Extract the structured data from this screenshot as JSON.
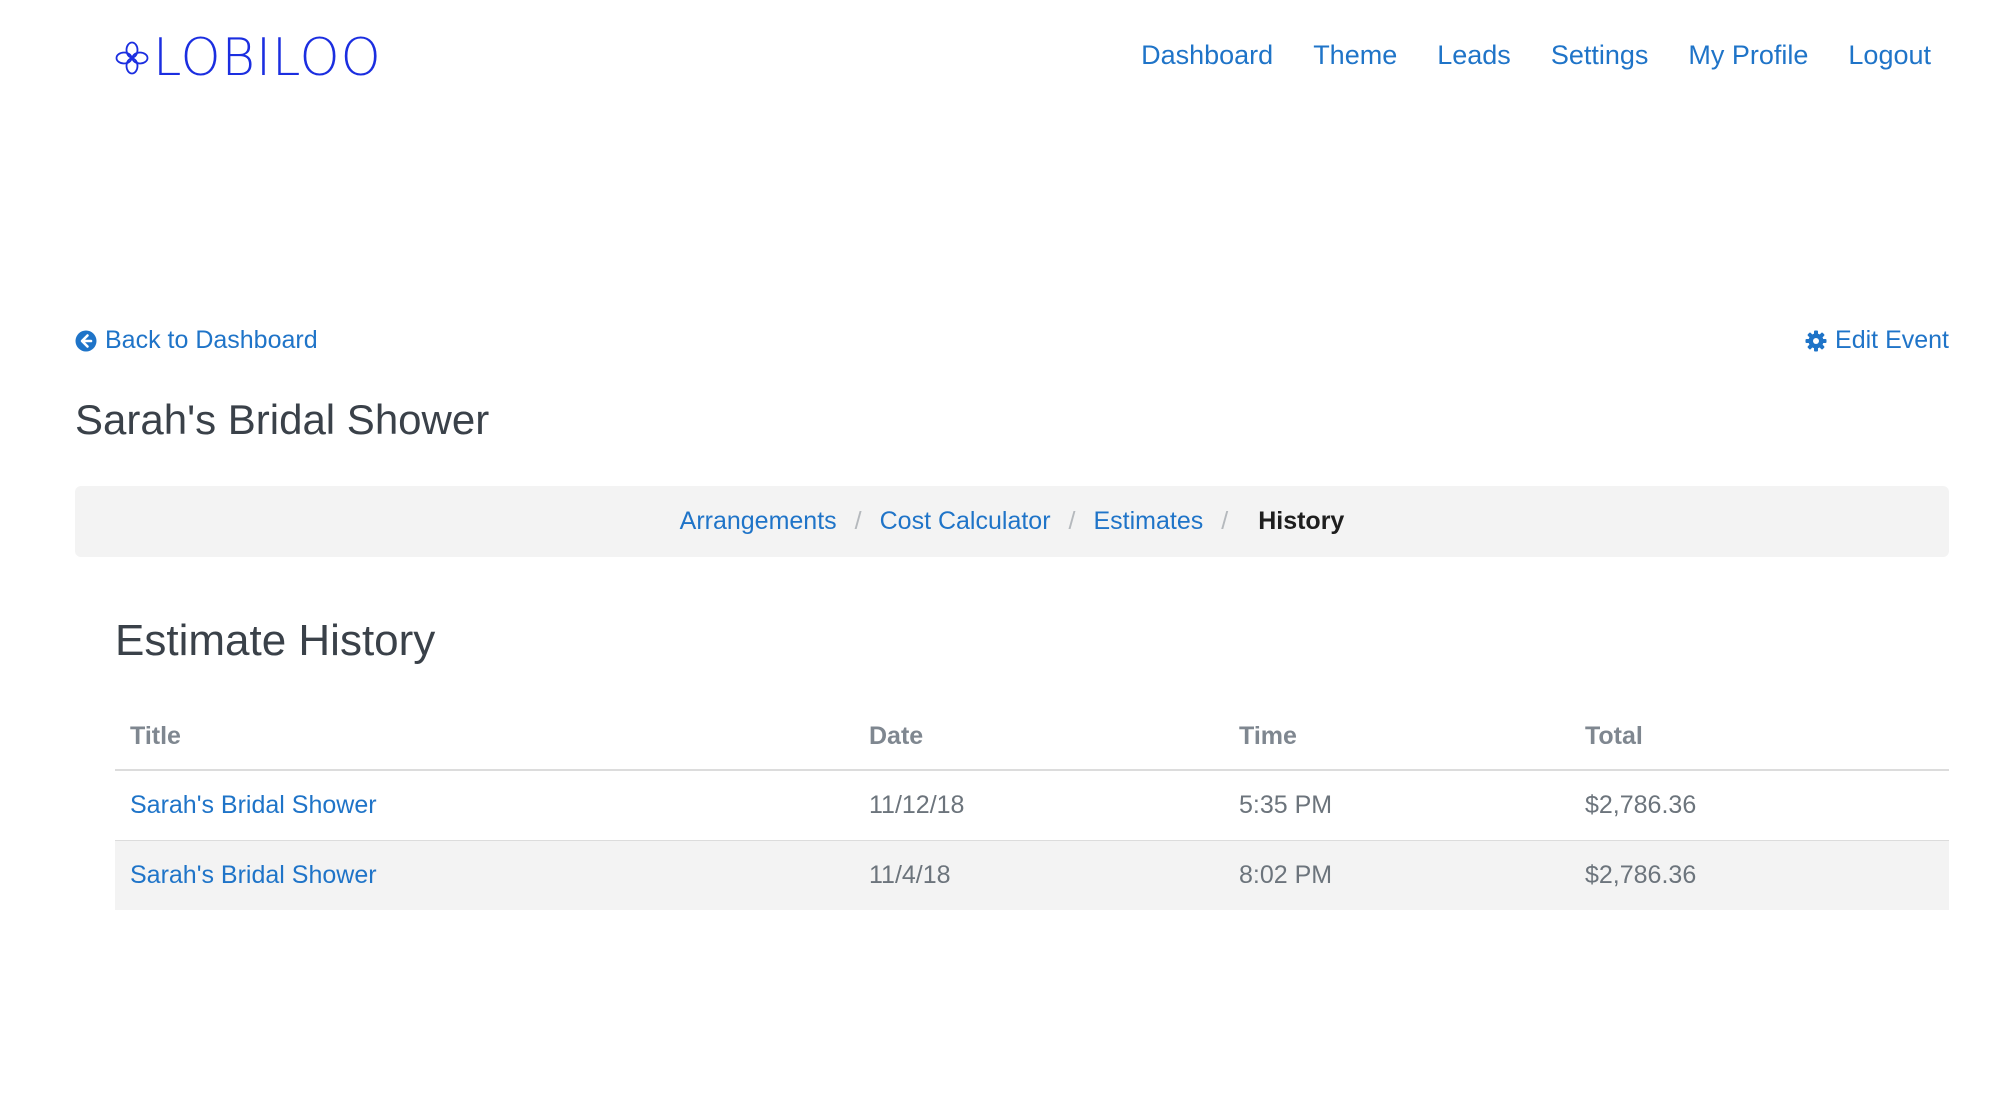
{
  "brand": {
    "name": "LOBILOO",
    "color": "#1b2ee0"
  },
  "nav": {
    "items": [
      {
        "label": "Dashboard"
      },
      {
        "label": "Theme"
      },
      {
        "label": "Leads"
      },
      {
        "label": "Settings"
      },
      {
        "label": "My Profile"
      },
      {
        "label": "Logout"
      }
    ]
  },
  "actions": {
    "back_label": "Back to Dashboard",
    "back_icon": "arrow-circle-left-icon",
    "edit_label": "Edit Event",
    "edit_icon": "gear-icon"
  },
  "event": {
    "title": "Sarah's Bridal Shower"
  },
  "breadcrumb": {
    "items": [
      {
        "label": "Arrangements"
      },
      {
        "label": "Cost Calculator"
      },
      {
        "label": "Estimates"
      }
    ],
    "separator": "/",
    "current": "History"
  },
  "history": {
    "title": "Estimate History",
    "columns": [
      "Title",
      "Date",
      "Time",
      "Total"
    ],
    "rows": [
      {
        "title": "Sarah's Bridal Shower",
        "date": "11/12/18",
        "time": "5:35 PM",
        "total": "$2,786.36"
      },
      {
        "title": "Sarah's Bridal Shower",
        "date": "11/4/18",
        "time": "8:02 PM",
        "total": "$2,786.36"
      }
    ]
  },
  "colors": {
    "link": "#1f74c8",
    "text": "#3a4149",
    "muted": "#7f8790",
    "stripe": "#f3f3f3"
  }
}
